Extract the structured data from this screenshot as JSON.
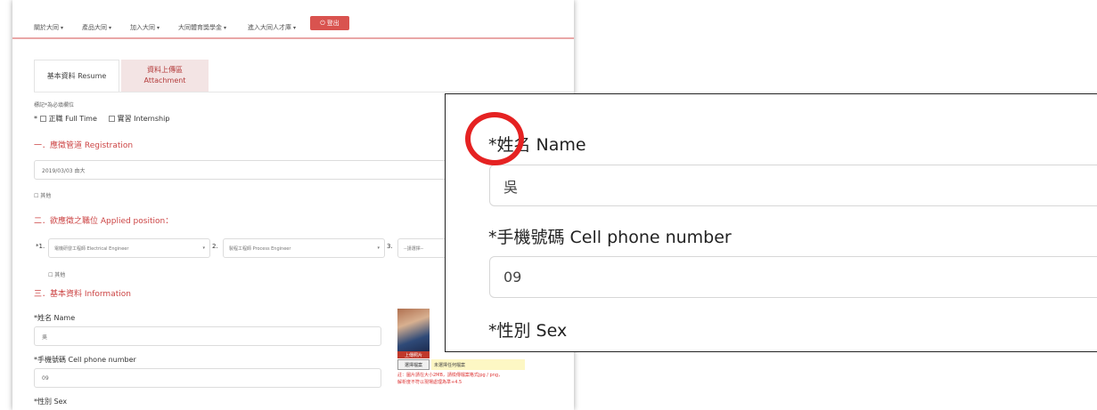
{
  "nav": {
    "items": [
      "關於大同",
      "產品大同",
      "加入大同",
      "大同體育獎學金",
      "進入大同人才庫"
    ],
    "caret": "▾",
    "login_icon": "power-icon",
    "login_label": "登出"
  },
  "tabs": {
    "resume": {
      "line1": "基本資料 Resume"
    },
    "attachment": {
      "line1": "資料上傳區",
      "line2": "Attachment"
    }
  },
  "form": {
    "required_note": "標記*為必填欄位",
    "job_full_time": "正職 Full Time",
    "job_internship": "實習 Internship",
    "section_registration": "一．應徵管道 Registration",
    "registration_value": "2019/03/03 由大",
    "other": "其他",
    "section_position": "二．欲應徵之職位 Applied position：",
    "pos1_num": "*1.",
    "pos1_value": "電機研發工程師 Electrical Engineer",
    "pos2_num": "2.",
    "pos2_value": "製程工程師 Process Engineer",
    "pos3_num": "3.",
    "pos3_value": "--請選擇--",
    "section_info": "三．基本資料 Information",
    "name_label": "*姓名 Name",
    "name_value": "吳",
    "phone_label": "*手機號碼 Cell phone number",
    "phone_value": "09",
    "sex_label": "*性別 Sex",
    "photo_caption": "上傳照片",
    "file_button": "選擇檔案",
    "file_status": "未選擇任何檔案",
    "upload_note_1": "註：圖片請在大小2MB，請檢傳檔案格式jpg / png，",
    "upload_note_2": "解析度不符以現場處理為準+4.5"
  },
  "zoom": {
    "name_label": "*姓名 Name",
    "name_value": "吳",
    "phone_label": "*手機號碼 Cell phone number",
    "phone_value": "09",
    "sex_label": "*性別 Sex"
  },
  "colors": {
    "accent": "#c44444",
    "login_button": "#d9534f",
    "highlight_circle": "#e52222"
  }
}
